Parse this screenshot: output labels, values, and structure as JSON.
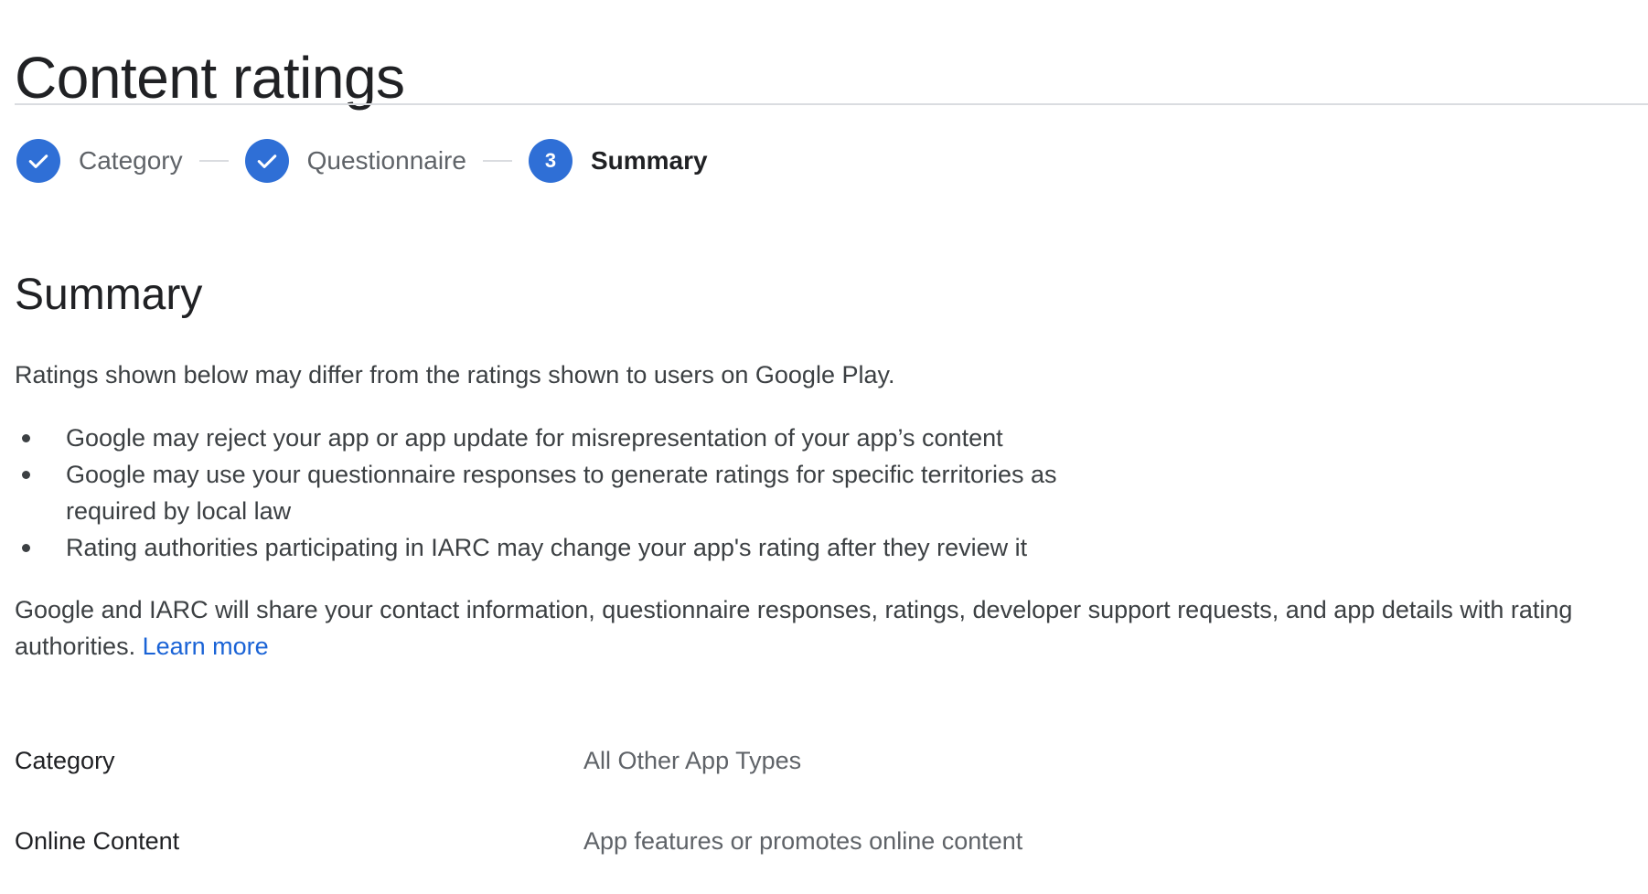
{
  "page": {
    "title": "Content ratings"
  },
  "stepper": {
    "steps": [
      {
        "label": "Category",
        "state": "complete",
        "icon": "check-icon"
      },
      {
        "label": "Questionnaire",
        "state": "complete",
        "icon": "check-icon"
      },
      {
        "label": "Summary",
        "state": "current",
        "number": "3"
      }
    ],
    "accent_color": "#2f6fd6"
  },
  "summary": {
    "heading": "Summary",
    "intro": "Ratings shown below may differ from the ratings shown to users on Google Play.",
    "bullets": [
      "Google may reject your app or app update for misrepresentation of your app’s content",
      "Google may use your questionnaire responses to generate ratings for specific territories as required by local law",
      "Rating authorities participating in IARC may change your app's rating after they review it"
    ],
    "share_note": "Google and IARC will share your contact information, questionnaire responses, ratings, developer support requests, and app details with rating authorities.",
    "learn_more_label": "Learn more",
    "link_color": "#1a63d6",
    "rows": [
      {
        "label": "Category",
        "value": "All Other App Types"
      },
      {
        "label": "Online Content",
        "value": "App features or promotes online content"
      }
    ]
  }
}
